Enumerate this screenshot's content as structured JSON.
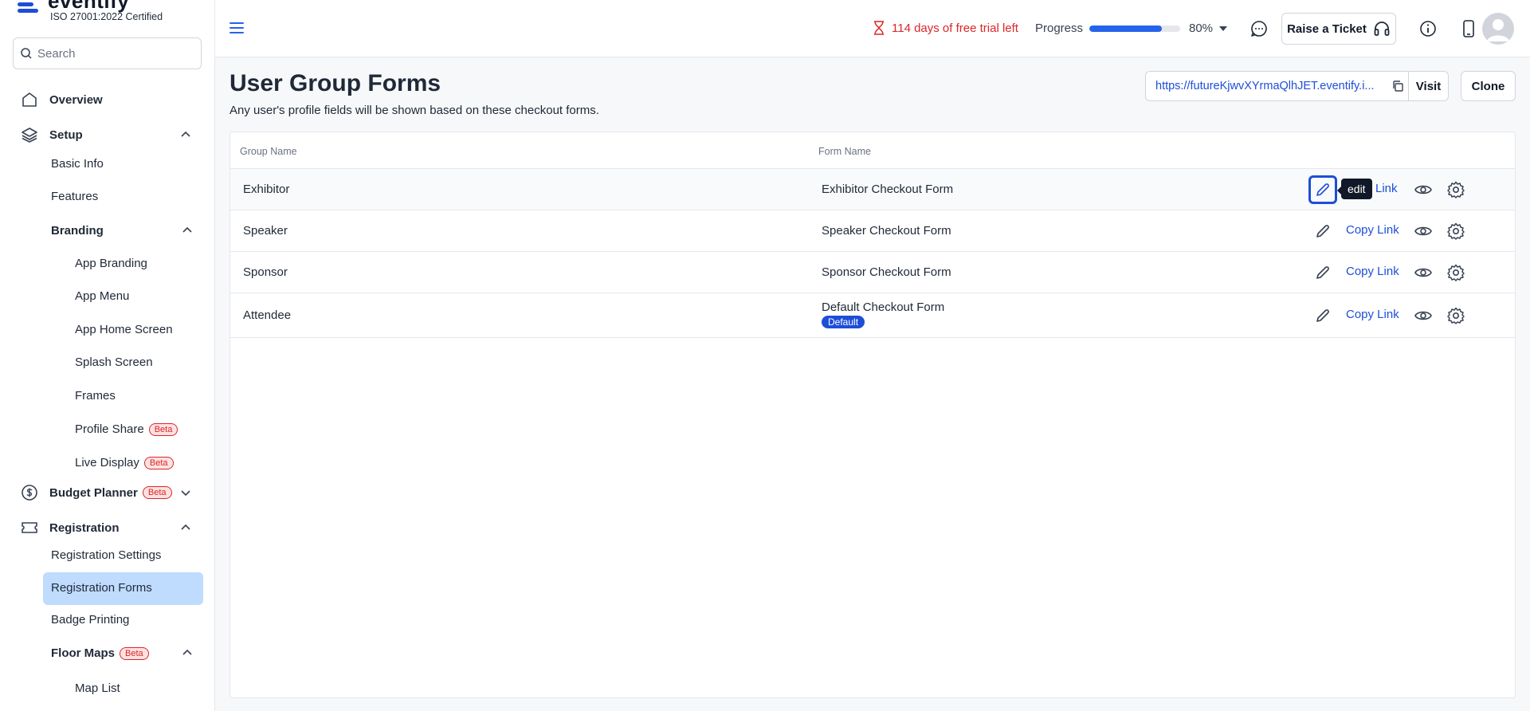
{
  "brand": {
    "name": "eventify",
    "certification": "ISO 27001:2022 Certified"
  },
  "search": {
    "placeholder": "Search"
  },
  "sidebar": {
    "items": {
      "overview": "Overview",
      "setup": "Setup",
      "basic_info": "Basic Info",
      "features": "Features",
      "branding": "Branding",
      "app_branding": "App Branding",
      "app_menu": "App Menu",
      "app_home_screen": "App Home Screen",
      "splash_screen": "Splash Screen",
      "frames": "Frames",
      "profile_share": "Profile Share",
      "live_display": "Live Display",
      "budget_planner": "Budget Planner",
      "registration": "Registration",
      "registration_settings": "Registration Settings",
      "registration_forms": "Registration Forms",
      "badge_printing": "Badge Printing",
      "floor_maps": "Floor Maps",
      "map_list": "Map List"
    },
    "beta_label": "Beta"
  },
  "header": {
    "trial_text": "114 days of free trial left",
    "progress_label": "Progress",
    "progress_value": "80%",
    "progress_fraction": 0.8,
    "ticket_button": "Raise a Ticket"
  },
  "page": {
    "title": "User Group Forms",
    "subtitle": "Any user's profile fields will be shown based on these checkout forms.",
    "url": "https://futureKjwvXYrmaQlhJET.eventify.i...",
    "visit_label": "Visit",
    "clone_label": "Clone"
  },
  "table": {
    "headers": {
      "group": "Group Name",
      "form": "Form Name"
    },
    "copy_link_label": "Copy Link",
    "partial_link_label": "Link",
    "default_badge": "Default",
    "tooltip": "edit",
    "rows": [
      {
        "group": "Exhibitor",
        "form": "Exhibitor Checkout Form"
      },
      {
        "group": "Speaker",
        "form": "Speaker Checkout Form"
      },
      {
        "group": "Sponsor",
        "form": "Sponsor Checkout Form"
      },
      {
        "group": "Attendee",
        "form": "Default Checkout Form"
      }
    ]
  },
  "colors": {
    "accent": "#1d4ed8",
    "trial_red": "#dc2626",
    "active_bg": "#bfdbfe"
  }
}
